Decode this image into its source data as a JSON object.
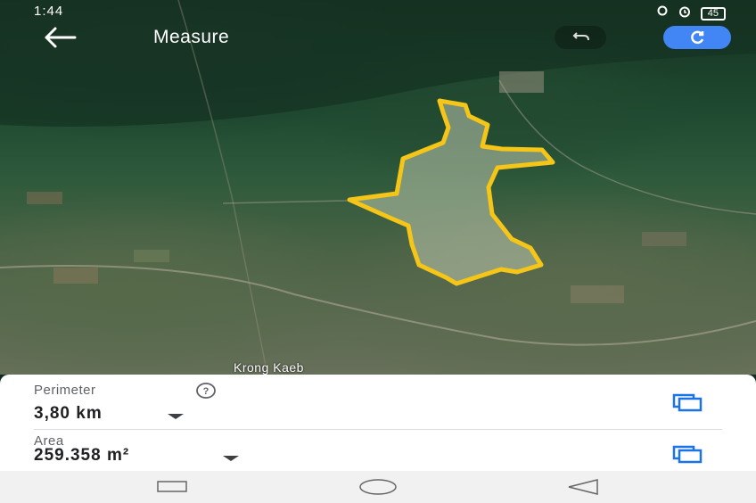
{
  "status_bar": {
    "time": "1:44",
    "battery": "45"
  },
  "toolbar": {
    "title": "Measure",
    "back_icon": "arrow-back-icon",
    "undo_icon": "undo-icon",
    "refresh_icon": "refresh-icon"
  },
  "map": {
    "place_label": "Krong Kaeb",
    "outline_color": "#f5c518"
  },
  "measurements": {
    "perimeter_label": "Perimeter",
    "perimeter_value": "3,80 km",
    "area_label": "Area",
    "area_value": "259.358 m²",
    "help_icon": "help-circle-icon",
    "copy_icon": "copy-icon",
    "accent_color": "#1a73e8"
  },
  "nav_bar": {
    "icons": [
      "recents-square-icon",
      "home-circle-icon",
      "back-triangle-icon"
    ]
  }
}
